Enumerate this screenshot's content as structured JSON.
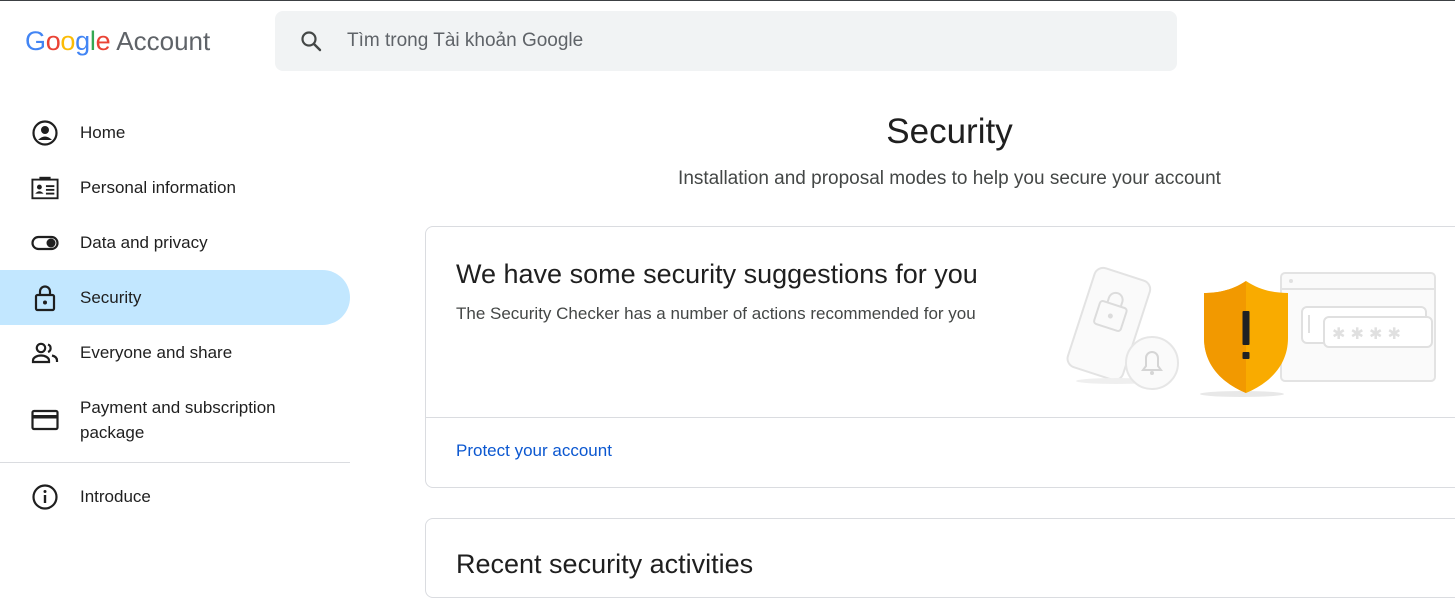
{
  "header": {
    "logo_google": "Google",
    "logo_account": "Account",
    "search_placeholder": "Tìm trong Tài khoản Google"
  },
  "sidebar": {
    "items": [
      {
        "label": "Home",
        "icon": "account-circle-icon"
      },
      {
        "label": "Personal information",
        "icon": "id-card-icon"
      },
      {
        "label": "Data and privacy",
        "icon": "toggle-icon"
      },
      {
        "label": "Security",
        "icon": "lock-icon",
        "active": true
      },
      {
        "label": "Everyone and share",
        "icon": "people-icon"
      },
      {
        "label": "Payment and subscription package",
        "icon": "credit-card-icon"
      }
    ],
    "footer_items": [
      {
        "label": "Introduce",
        "icon": "info-icon"
      }
    ]
  },
  "main": {
    "title": "Security",
    "subtitle": "Installation and proposal modes to help you secure your account",
    "suggestions_card": {
      "title": "We have some security suggestions for you",
      "description": "The Security Checker has a number of actions recommended for you",
      "link": "Protect your account",
      "illustration": "security-shield-warning-illustration"
    },
    "next_card": {
      "title": "Recent security activities"
    }
  },
  "colors": {
    "active_nav_bg": "#c2e7ff",
    "link": "#0b57d0",
    "shield": "#f9ab00",
    "search_bg": "#f1f3f4"
  }
}
